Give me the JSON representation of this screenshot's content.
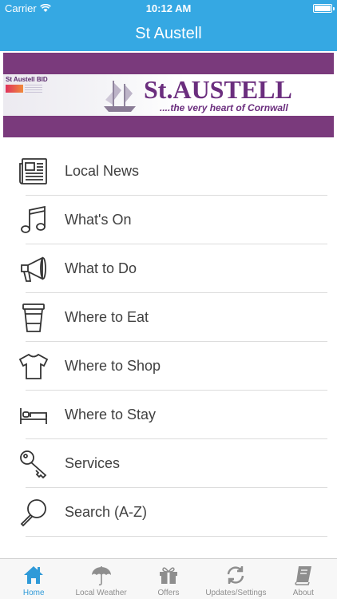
{
  "status_bar": {
    "carrier": "Carrier",
    "time": "10:12 AM"
  },
  "nav": {
    "title": "St Austell"
  },
  "banner": {
    "bid_label": "St Austell BID",
    "title": "St.AUSTELL",
    "tagline": "....the very heart of Cornwall",
    "background_color": "#7a3a7c"
  },
  "menu": {
    "items": [
      {
        "label": "Local News",
        "icon": "newspaper-icon"
      },
      {
        "label": "What's On",
        "icon": "music-note-icon"
      },
      {
        "label": "What to Do",
        "icon": "megaphone-icon"
      },
      {
        "label": "Where to Eat",
        "icon": "coffee-cup-icon"
      },
      {
        "label": "Where to Shop",
        "icon": "tshirt-icon"
      },
      {
        "label": "Where to Stay",
        "icon": "bed-icon"
      },
      {
        "label": "Services",
        "icon": "key-icon"
      },
      {
        "label": "Search (A-Z)",
        "icon": "magnifier-icon"
      }
    ]
  },
  "tab_bar": {
    "tabs": [
      {
        "label": "Home",
        "icon": "home-icon",
        "active": true
      },
      {
        "label": "Local Weather",
        "icon": "umbrella-icon",
        "active": false
      },
      {
        "label": "Offers",
        "icon": "gift-icon",
        "active": false
      },
      {
        "label": "Updates/Settings",
        "icon": "refresh-icon",
        "active": false
      },
      {
        "label": "About",
        "icon": "book-icon",
        "active": false
      }
    ]
  },
  "colors": {
    "accent": "#35a8e3",
    "active_tab": "#2f9ad8",
    "text": "#404040"
  }
}
